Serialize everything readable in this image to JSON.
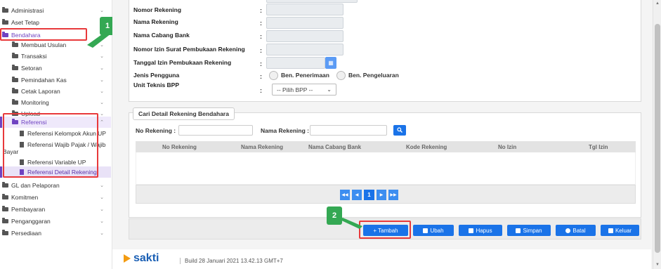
{
  "sidebar": {
    "items": [
      {
        "label": "Administrasi"
      },
      {
        "label": "Aset Tetap"
      },
      {
        "label": "Bendahara"
      },
      {
        "label": "Membuat Usulan"
      },
      {
        "label": "Transaksi"
      },
      {
        "label": "Setoran"
      },
      {
        "label": "Pemindahan Kas"
      },
      {
        "label": "Cetak Laporan"
      },
      {
        "label": "Monitoring"
      },
      {
        "label": "Upload"
      },
      {
        "label": "Referensi"
      },
      {
        "label": "Referensi Kelompok Akun UP"
      },
      {
        "label": "Referensi Wajib Pajak / Wajib"
      },
      {
        "label": "Bayar"
      },
      {
        "label": "Referensi Variable UP"
      },
      {
        "label": "Referensi Detail Rekening"
      },
      {
        "label": "GL dan Pelaporan"
      },
      {
        "label": "Komitmen"
      },
      {
        "label": "Pembayaran"
      },
      {
        "label": "Penganggaran"
      },
      {
        "label": "Persediaan"
      }
    ]
  },
  "badges": {
    "one": "1",
    "two": "2"
  },
  "form": {
    "nomor_rekening": "Nomor Rekening",
    "nama_rekening": "Nama Rekening",
    "nama_cabang_bank": "Nama Cabang Bank",
    "nomor_izin": "Nomor Izin Surat Pembukaan Rekening",
    "tanggal_izin": "Tanggal Izin Pembukaan Rekening",
    "jenis_pengguna": "Jenis Pengguna",
    "unit_teknis": "Unit Teknis BPP",
    "colon": ":",
    "radio_penerimaan": "Ben. Penerimaan",
    "radio_pengeluaran": "Ben. Pengeluaran",
    "bpp_select": "-- Pilih BPP --"
  },
  "detail": {
    "title": "Cari Detail Rekening Bendahara",
    "no_rekening_label": "No Rekening :",
    "nama_rekening_label": "Nama Rekening :",
    "columns": [
      "No Rekening",
      "Nama Rekening",
      "Nama Cabang Bank",
      "Kode Rekening",
      "No Izin",
      "Tgl Izin"
    ],
    "current_page": "1"
  },
  "actions": {
    "tambah": "+ Tambah",
    "ubah": "Ubah",
    "hapus": "Hapus",
    "simpan": "Simpan",
    "batal": "Batal",
    "keluar": "Keluar"
  },
  "footer": {
    "logo": "sakti",
    "build": "Build 28 Januari 2021 13.42.13 GMT+7"
  },
  "colors": {
    "accent": "#1a73e8",
    "sidebar_active": "#6f42c1",
    "annotation_red": "#e8393b",
    "annotation_green": "#34a853"
  }
}
